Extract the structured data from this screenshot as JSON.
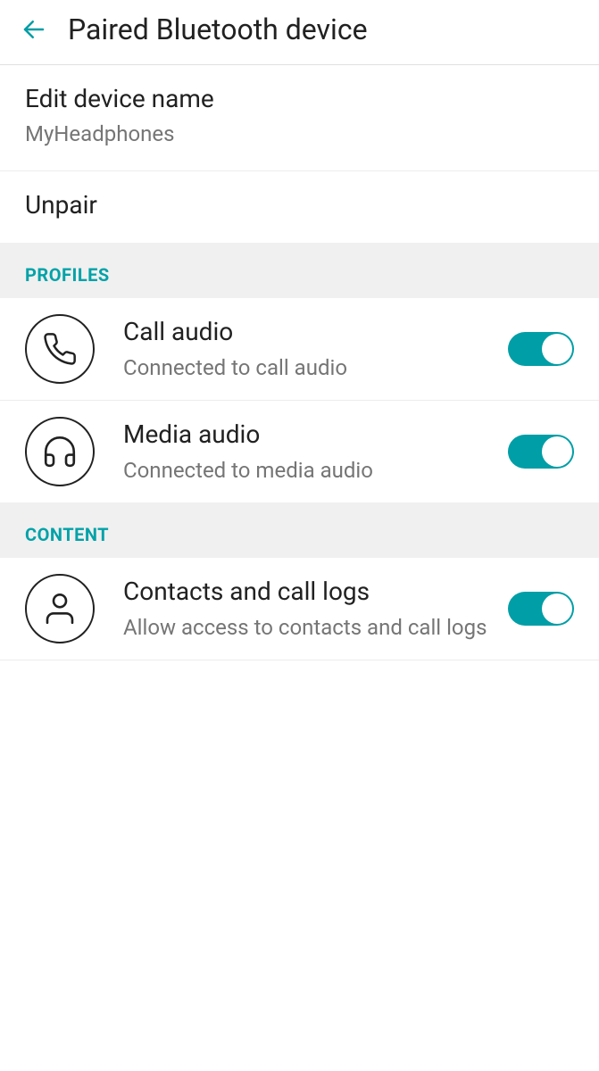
{
  "header": {
    "title": "Paired Bluetooth device"
  },
  "editName": {
    "title": "Edit device name",
    "value": "MyHeadphones"
  },
  "unpair": {
    "label": "Unpair"
  },
  "sections": {
    "profiles": {
      "header": "PROFILES",
      "items": [
        {
          "title": "Call audio",
          "subtitle": "Connected to call audio",
          "toggled": true
        },
        {
          "title": "Media audio",
          "subtitle": "Connected to media audio",
          "toggled": true
        }
      ]
    },
    "content": {
      "header": "CONTENT",
      "items": [
        {
          "title": "Contacts and call logs",
          "subtitle": "Allow access to contacts and call logs",
          "toggled": true
        }
      ]
    }
  },
  "colors": {
    "accent": "#009ea6",
    "text": "#212121",
    "secondaryText": "#757575",
    "sectionBg": "#f0f0f0"
  }
}
